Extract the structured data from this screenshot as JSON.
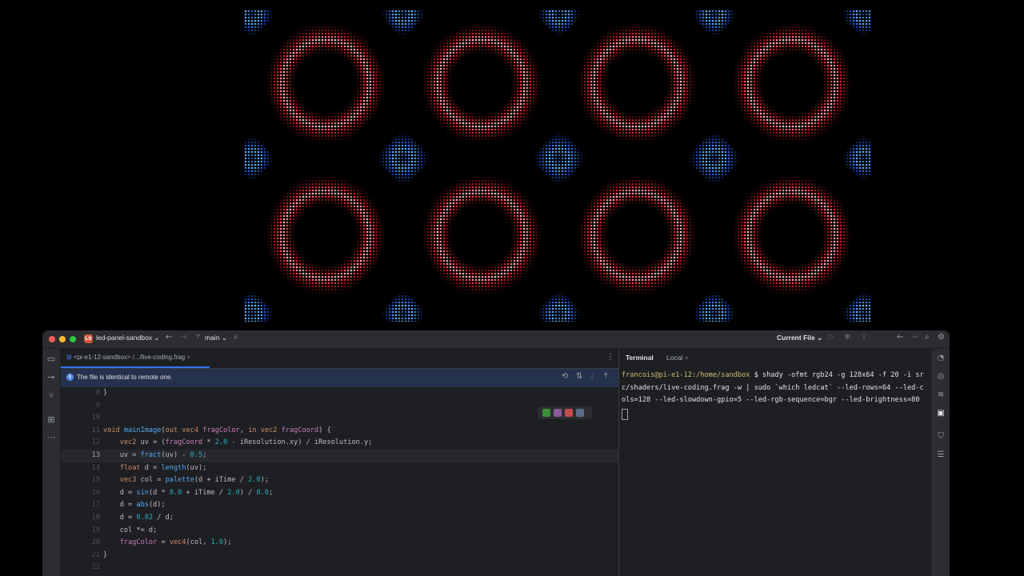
{
  "titlebar": {
    "project_badge": "LS",
    "project_name": "led-panel-sandbox",
    "branch": "main",
    "run_config": "Current File"
  },
  "editor": {
    "tab_label": "<pi-e1-12-sandbox> /.../live-coding.frag",
    "notice": "The file is identical to remote one.",
    "lines": [
      {
        "n": "8",
        "text": "}"
      },
      {
        "n": "9",
        "text": ""
      },
      {
        "n": "10",
        "text": ""
      },
      {
        "n": "11",
        "text": "void mainImage(out vec4 fragColor, in vec2 fragCoord) {"
      },
      {
        "n": "12",
        "text": "    vec2 uv = (fragCoord * 2.0 - iResolution.xy) / iResolution.y;"
      },
      {
        "n": "13",
        "text": "    uv = fract(uv) - 0.5;"
      },
      {
        "n": "14",
        "text": "    float d = length(uv);"
      },
      {
        "n": "15",
        "text": "    vec3 col = palette(d + iTime / 2.0);"
      },
      {
        "n": "16",
        "text": "    d = sin(d * 8.0 + iTime / 2.0) / 8.0;"
      },
      {
        "n": "17",
        "text": "    d = abs(d);"
      },
      {
        "n": "18",
        "text": "    d = 0.02 / d;"
      },
      {
        "n": "19",
        "text": "    col *= d;"
      },
      {
        "n": "20",
        "text": "    fragColor = vec4(col, 1.0);"
      },
      {
        "n": "21",
        "text": "}"
      },
      {
        "n": "22",
        "text": ""
      }
    ],
    "current_line": "13"
  },
  "terminal": {
    "title": "Terminal",
    "tab": "Local",
    "prompt_user": "francois@pi-e1-12:/home/sandbox",
    "command": " $ shady -ofmt rgb24 -g 128x64 -f 20 -i src/shaders/live-coding.frag -w | sudo `which ledcat` --led-rows=64 --led-cols=128 --led-slowdown-gpio=5 --led-rgb-sequence=bgr --led-brightness=80"
  },
  "led_panel": {
    "rings": 8,
    "diamonds": 3,
    "ring_color": "#e8232b",
    "diamond_color": "#2b7ff0"
  },
  "colors": {
    "accent": "#3574f0",
    "notice_bg": "#25324d"
  }
}
